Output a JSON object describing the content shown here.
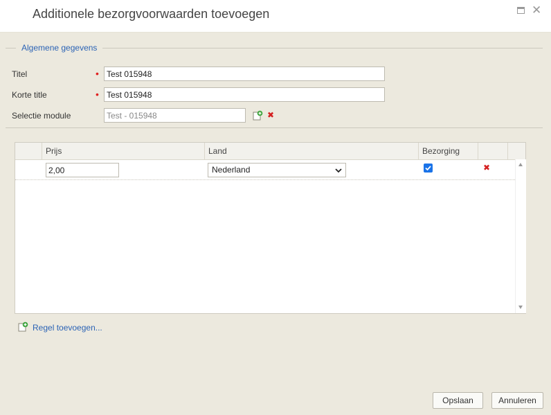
{
  "dialog": {
    "title": "Additionele bezorgvoorwaarden toevoegen"
  },
  "section": {
    "legend": "Algemene gegevens"
  },
  "form": {
    "titel": {
      "label": "Titel",
      "value": "Test 015948"
    },
    "korte_title": {
      "label": "Korte title",
      "value": "Test 015948"
    },
    "selectie_module": {
      "label": "Selectie module",
      "value": "Test - 015948"
    }
  },
  "grid": {
    "columns": [
      "Prijs",
      "Land",
      "Bezorging"
    ],
    "rows": [
      {
        "prijs": "2,00",
        "land": "Nederland",
        "bezorging": true
      }
    ]
  },
  "add_row_label": "Regel toevoegen...",
  "buttons": {
    "save": "Opslaan",
    "cancel": "Annuleren"
  },
  "colors": {
    "accent": "#2b63b5",
    "required": "#e02020",
    "delete": "#d42020",
    "checkbox": "#1a73e8",
    "panel_background": "#ece9de"
  }
}
